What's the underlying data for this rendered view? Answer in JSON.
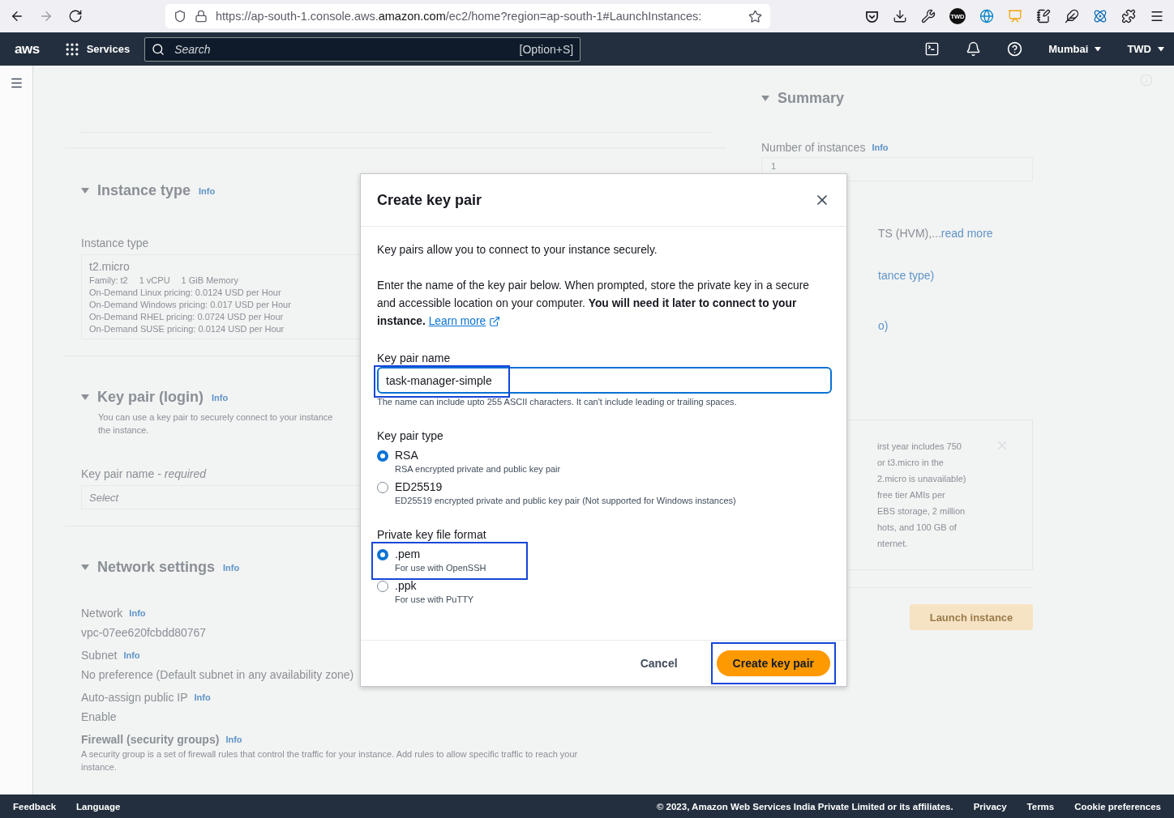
{
  "browser": {
    "url_start": "https://ap-south-1.console.aws.",
    "url_domain": "amazon.com",
    "url_end": "/ec2/home?region=ap-south-1#LaunchInstances:",
    "profile_badge": "TWD"
  },
  "nav": {
    "logo": "aws",
    "services": "Services",
    "search_placeholder": "Search",
    "shortcut": "[Option+S]",
    "region": "Mumbai",
    "account": "TWD"
  },
  "instance_type": {
    "title": "Instance type",
    "info": "Info",
    "label": "Instance type",
    "value": "t2.micro",
    "specs": [
      "Family: t2",
      "1 vCPU",
      "1 GiB Memory"
    ],
    "pricing": [
      "On-Demand Linux pricing: 0.0124 USD per Hour",
      "On-Demand Windows pricing: 0.017 USD per Hour",
      "On-Demand RHEL pricing: 0.0724 USD per Hour",
      "On-Demand SUSE pricing: 0.0124 USD per Hour"
    ]
  },
  "key_pair": {
    "title": "Key pair (login)",
    "info": "Info",
    "description_lines": [
      "You can use a key pair to securely connect to your instance",
      "the instance."
    ],
    "label": "Key pair name - ",
    "label_required": "required",
    "placeholder": "Select"
  },
  "network": {
    "title": "Network settings",
    "info": "Info",
    "fields": [
      {
        "label": "Network",
        "info": "Info",
        "value": "vpc-07ee620fcbdd80767"
      },
      {
        "label": "Subnet",
        "info": "Info",
        "value": "No preference (Default subnet in any availability zone)"
      },
      {
        "label": "Auto-assign public IP",
        "info": "Info",
        "value": "Enable"
      }
    ],
    "firewall": {
      "label": "Firewall (security groups)",
      "info": "Info",
      "description_lines": [
        "A security group is a set of firewall rules that control the traffic for your instance. Add rules to allow specific traffic to reach your",
        "instance."
      ]
    }
  },
  "summary": {
    "title": "Summary",
    "instances_label": "Number of instances",
    "info": "Info",
    "instances_value": "1",
    "ami_text": "TS (HVM),...",
    "ami_link": "read more",
    "type_link": "tance type)",
    "storage_link": "o)",
    "free_tier_lines": [
      "irst year includes 750",
      "or t3.micro in the",
      "2.micro is unavailable)",
      "free tier AMIs per",
      "EBS storage, 2 million",
      "hots, and 100 GB of",
      "nternet."
    ],
    "launch": "Launch instance"
  },
  "modal": {
    "title": "Create key pair",
    "intro": "Key pairs allow you to connect to your instance securely.",
    "body": "Enter the name of the key pair below. When prompted, store the private key in a secure and accessible location on your computer. **You will need it later to connect to your instance.**",
    "learn_more": "Learn more",
    "name_field": {
      "label": "Key pair name",
      "value": "task-manager-simple",
      "hint": "The name can include upto 255 ASCII characters. It can't include leading or trailing spaces.",
      "highlighted": true
    },
    "type_group": {
      "label": "Key pair type",
      "options": [
        {
          "label": "RSA",
          "description": "RSA encrypted private and public key pair",
          "selected": true,
          "highlighted": false
        },
        {
          "label": "ED25519",
          "description": "ED25519 encrypted private and public key pair (Not supported for Windows instances)",
          "selected": false,
          "highlighted": false
        }
      ]
    },
    "format_group": {
      "label": "Private key file format",
      "options": [
        {
          "label": ".pem",
          "description": "For use with OpenSSH",
          "selected": true,
          "highlighted": true
        },
        {
          "label": ".ppk",
          "description": "For use with PuTTY",
          "selected": false,
          "highlighted": false
        }
      ]
    },
    "buttons": [
      {
        "label": "Cancel",
        "kind": "link",
        "highlighted": false
      },
      {
        "label": "Create key pair",
        "kind": "primary",
        "highlighted": true
      }
    ]
  },
  "footer": {
    "left": [
      "Feedback",
      "Language"
    ],
    "copyright": "© 2023, Amazon Web Services India Private Limited or its affiliates.",
    "links": [
      "Privacy",
      "Terms",
      "Cookie preferences"
    ]
  }
}
